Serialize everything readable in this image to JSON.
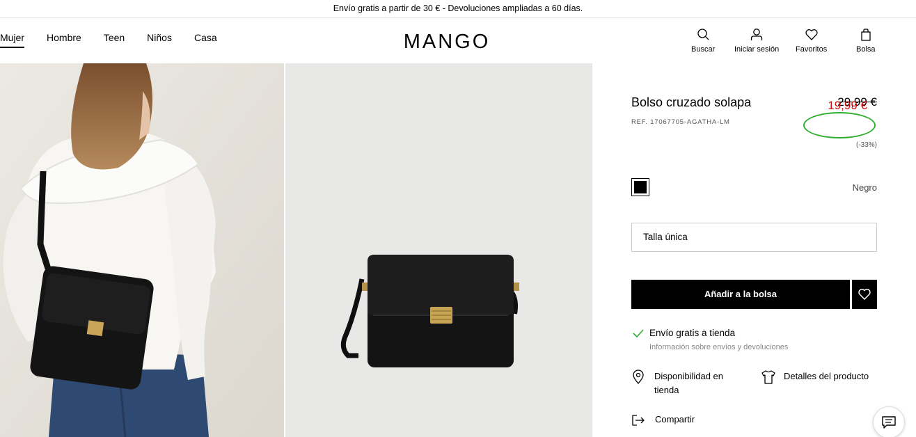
{
  "promo": {
    "text": "Envío gratis a partir de 30 € - Devoluciones ampliadas a 60 días."
  },
  "nav": {
    "items": [
      "Mujer",
      "Hombre",
      "Teen",
      "Niños",
      "Casa"
    ],
    "active": "Mujer"
  },
  "logo": {
    "text": "MANGO"
  },
  "utility": {
    "search": "Buscar",
    "login": "Iniciar sesión",
    "favorites": "Favoritos",
    "bag": "Bolsa"
  },
  "product": {
    "title": "Bolso cruzado solapa",
    "ref": "REF. 17067705-AGATHA-LM",
    "original_price": "29,99 €",
    "sale_price": "19,99 €",
    "discount": "(-33%)",
    "color_name": "Negro",
    "size": "Talla única",
    "add_button": "Añadir a la bolsa",
    "shipping_title": "Envío gratis a tienda",
    "shipping_link": "Información sobre envíos y devoluciones",
    "store_availability": "Disponibilidad en tienda",
    "details": "Detalles del producto",
    "share": "Compartir"
  },
  "colors": {
    "sale_price": "#d10f0f",
    "highlight_circle": "#2fae2f",
    "check": "#2fae2f",
    "primary": "#000000"
  },
  "icons": [
    "search-icon",
    "user-icon",
    "heart-icon",
    "bag-icon",
    "check-icon",
    "location-pin-icon",
    "shirt-icon",
    "share-icon",
    "chat-icon"
  ]
}
